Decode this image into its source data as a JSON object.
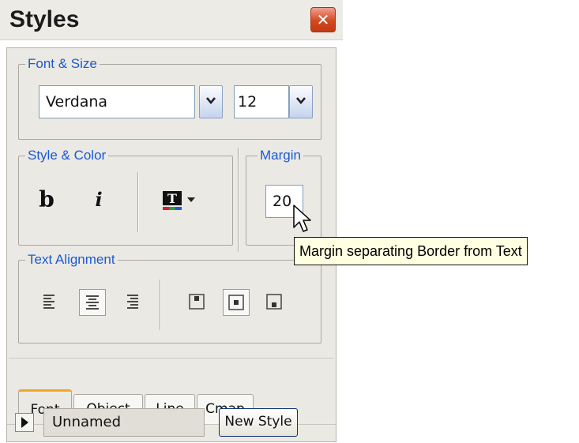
{
  "window": {
    "title": "Styles",
    "close_icon": "close-icon"
  },
  "font_size_group": {
    "label": "Font & Size",
    "font_value": "Verdana",
    "size_value": "12"
  },
  "style_color_group": {
    "label": "Style & Color",
    "bold_label": "b",
    "italic_label": "i",
    "text_color_icon": "text-color-icon"
  },
  "margin_group": {
    "label": "Margin",
    "value": "20"
  },
  "tooltip": {
    "text": "Margin separating Border from Text"
  },
  "text_alignment_group": {
    "label": "Text Alignment",
    "buttons": [
      "align-left-icon",
      "align-center-icon",
      "align-right-icon",
      "valign-top-icon",
      "valign-middle-icon",
      "valign-bottom-icon"
    ],
    "selected": [
      "align-center-icon",
      "valign-middle-icon"
    ]
  },
  "tabs": [
    {
      "label": "Font",
      "active": true
    },
    {
      "label": "Object",
      "active": false
    },
    {
      "label": "Line",
      "active": false
    },
    {
      "label": "Cmap",
      "active": false
    }
  ],
  "style_bar": {
    "style_name": "Unnamed",
    "new_style_label": "New Style"
  },
  "colors": {
    "accent": "#1a5ad6",
    "tab_highlight": "#f4a628",
    "close_button": "#d4481f",
    "tooltip_bg": "#ffffe1"
  }
}
